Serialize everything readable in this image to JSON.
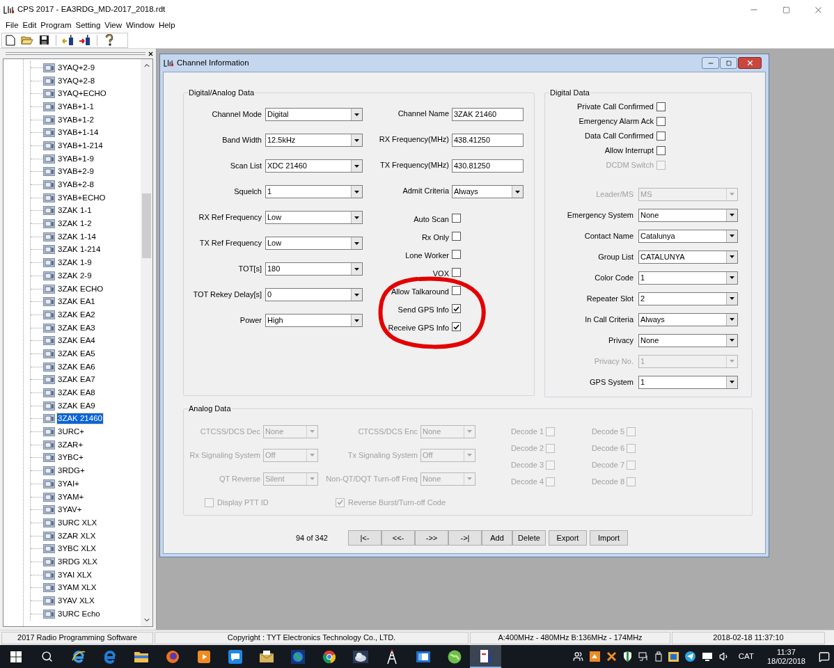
{
  "window": {
    "title": "CPS 2017 - EA3RDG_MD-2017_2018.rdt"
  },
  "menu": [
    "File",
    "Edit",
    "Program",
    "Setting",
    "View",
    "Window",
    "Help"
  ],
  "toolbar": [
    {
      "kind": "new"
    },
    {
      "kind": "open"
    },
    {
      "kind": "save"
    },
    {
      "kind": "read"
    },
    {
      "kind": "write"
    },
    {
      "kind": "help"
    }
  ],
  "tree": {
    "items": [
      {
        "label": "3YAQ+2-9",
        "selected": false
      },
      {
        "label": "3YAQ+2-8",
        "selected": false
      },
      {
        "label": "3YAQ+ECHO",
        "selected": false
      },
      {
        "label": "3YAB+1-1",
        "selected": false
      },
      {
        "label": "3YAB+1-2",
        "selected": false
      },
      {
        "label": "3YAB+1-14",
        "selected": false
      },
      {
        "label": "3YAB+1-214",
        "selected": false
      },
      {
        "label": "3YAB+1-9",
        "selected": false
      },
      {
        "label": "3YAB+2-9",
        "selected": false
      },
      {
        "label": "3YAB+2-8",
        "selected": false
      },
      {
        "label": "3YAB+ECHO",
        "selected": false
      },
      {
        "label": "3ZAK 1-1",
        "selected": false
      },
      {
        "label": "3ZAK 1-2",
        "selected": false
      },
      {
        "label": "3ZAK 1-14",
        "selected": false
      },
      {
        "label": "3ZAK 1-214",
        "selected": false
      },
      {
        "label": "3ZAK 1-9",
        "selected": false
      },
      {
        "label": "3ZAK 2-9",
        "selected": false
      },
      {
        "label": "3ZAK ECHO",
        "selected": false
      },
      {
        "label": "3ZAK EA1",
        "selected": false
      },
      {
        "label": "3ZAK EA2",
        "selected": false
      },
      {
        "label": "3ZAK EA3",
        "selected": false
      },
      {
        "label": "3ZAK EA4",
        "selected": false
      },
      {
        "label": "3ZAK EA5",
        "selected": false
      },
      {
        "label": "3ZAK EA6",
        "selected": false
      },
      {
        "label": "3ZAK EA7",
        "selected": false
      },
      {
        "label": "3ZAK EA8",
        "selected": false
      },
      {
        "label": "3ZAK EA9",
        "selected": false
      },
      {
        "label": "3ZAK 21460",
        "selected": true
      },
      {
        "label": "3URC+",
        "selected": false
      },
      {
        "label": "3ZAR+",
        "selected": false
      },
      {
        "label": "3YBC+",
        "selected": false
      },
      {
        "label": "3RDG+",
        "selected": false
      },
      {
        "label": "3YAI+",
        "selected": false
      },
      {
        "label": "3YAM+",
        "selected": false
      },
      {
        "label": "3YAV+",
        "selected": false
      },
      {
        "label": "3URC XLX",
        "selected": false
      },
      {
        "label": "3ZAR XLX",
        "selected": false
      },
      {
        "label": "3YBC XLX",
        "selected": false
      },
      {
        "label": "3RDG XLX",
        "selected": false
      },
      {
        "label": "3YAI XLX",
        "selected": false
      },
      {
        "label": "3YAM XLX",
        "selected": false
      },
      {
        "label": "3YAV XLX",
        "selected": false
      },
      {
        "label": "3URC Echo",
        "selected": false
      }
    ]
  },
  "channel_window": {
    "title": "Channel Information",
    "digital_analog": {
      "title": "Digital/Analog Data",
      "left_fields": [
        {
          "label": "Channel Mode",
          "value": "Digital"
        },
        {
          "label": "Band Width",
          "value": "12.5kHz"
        },
        {
          "label": "Scan List",
          "value": "XDC 21460"
        },
        {
          "label": "Squelch",
          "value": "1"
        },
        {
          "label": "RX Ref Frequency",
          "value": "Low"
        },
        {
          "label": "TX Ref Frequency",
          "value": "Low"
        },
        {
          "label": "TOT[s]",
          "value": "180"
        },
        {
          "label": "TOT Rekey Delay[s]",
          "value": "0"
        },
        {
          "label": "Power",
          "value": "High"
        }
      ],
      "right_fields": [
        {
          "kind": "text",
          "label": "Channel Name",
          "value": "3ZAK 21460"
        },
        {
          "kind": "text",
          "label": "RX Frequency(MHz)",
          "value": "438.41250"
        },
        {
          "kind": "text",
          "label": "TX Frequency(MHz)",
          "value": "430.81250"
        },
        {
          "kind": "combo",
          "label": "Admit Criteria",
          "value": "Always"
        },
        {
          "kind": "checkbox",
          "label": "Auto Scan",
          "checked": false
        },
        {
          "kind": "checkbox",
          "label": "Rx Only",
          "checked": false
        },
        {
          "kind": "checkbox",
          "label": "Lone Worker",
          "checked": false
        },
        {
          "kind": "checkbox",
          "label": "VOX",
          "checked": false
        },
        {
          "kind": "checkbox",
          "label": "Allow Talkaround",
          "checked": false
        },
        {
          "kind": "checkbox",
          "label": "Send GPS Info",
          "checked": true
        },
        {
          "kind": "checkbox",
          "label": "Receive GPS Info",
          "checked": true
        }
      ]
    },
    "digital": {
      "title": "Digital Data",
      "checkboxes": [
        {
          "label": "Private Call Confirmed",
          "checked": false,
          "disabled": false
        },
        {
          "label": "Emergency Alarm Ack",
          "checked": false,
          "disabled": false
        },
        {
          "label": "Data Call Confirmed",
          "checked": false,
          "disabled": false
        },
        {
          "label": "Allow Interrupt",
          "checked": false,
          "disabled": false
        },
        {
          "label": "DCDM Switch",
          "checked": false,
          "disabled": true
        }
      ],
      "fields": [
        {
          "label": "Leader/MS",
          "value": "MS",
          "disabled": true
        },
        {
          "label": "Emergency System",
          "value": "None",
          "disabled": false
        },
        {
          "label": "Contact Name",
          "value": "Catalunya",
          "disabled": false
        },
        {
          "label": "Group List",
          "value": "CATALUNYA",
          "disabled": false
        },
        {
          "label": "Color Code",
          "value": "1",
          "disabled": false
        },
        {
          "label": "Repeater Slot",
          "value": "2",
          "disabled": false
        },
        {
          "label": "In Call Criteria",
          "value": "Always",
          "disabled": false
        },
        {
          "label": "Privacy",
          "value": "None",
          "disabled": false
        },
        {
          "label": "Privacy No.",
          "value": "1",
          "disabled": true
        },
        {
          "label": "GPS System",
          "value": "1",
          "disabled": false
        }
      ]
    },
    "analog": {
      "title": "Analog Data",
      "disabled": true,
      "left_fields": [
        {
          "label": "CTCSS/DCS Dec",
          "value": "None"
        },
        {
          "label": "Rx Signaling System",
          "value": "Off"
        },
        {
          "label": "QT Reverse",
          "value": "Silent"
        }
      ],
      "right_fields": [
        {
          "label": "CTCSS/DCS Enc",
          "value": "None"
        },
        {
          "label": "Tx Signaling System",
          "value": "Off"
        },
        {
          "label": "Non-QT/DQT Turn-off Freq",
          "value": "None"
        }
      ],
      "decodes": [
        {
          "label": "Decode 1",
          "checked": false
        },
        {
          "label": "Decode 2",
          "checked": false
        },
        {
          "label": "Decode 3",
          "checked": false
        },
        {
          "label": "Decode 4",
          "checked": false
        },
        {
          "label": "Decode 5",
          "checked": false
        },
        {
          "label": "Decode 6",
          "checked": false
        },
        {
          "label": "Decode 7",
          "checked": false
        },
        {
          "label": "Decode 8",
          "checked": false
        }
      ],
      "options": [
        {
          "label": "Display PTT ID",
          "checked": false
        },
        {
          "label": "Reverse Burst/Turn-off Code",
          "checked": true
        }
      ]
    },
    "navigation": {
      "position": "94 of 342",
      "buttons": [
        "|<-",
        "<<-",
        "->>",
        "->|",
        "Add",
        "Delete",
        "Export",
        "Import"
      ]
    }
  },
  "status_bar": [
    "2017 Radio Programming Software",
    "Copyright : TYT Electronics Technology Co., LTD.",
    "A:400MHz - 480MHz B:136MHz - 174MHz",
    "2018-02-18 11:37:10"
  ],
  "taskbar": {
    "apps": [
      {
        "kind": "windows",
        "selected": false
      },
      {
        "kind": "search",
        "selected": false
      },
      {
        "kind": "ie",
        "selected": false
      },
      {
        "kind": "edge",
        "selected": false
      },
      {
        "kind": "folder",
        "selected": false
      },
      {
        "kind": "firefox",
        "selected": false
      },
      {
        "kind": "player",
        "selected": false
      },
      {
        "kind": "chat",
        "selected": false
      },
      {
        "kind": "mail",
        "selected": false
      },
      {
        "kind": "globe",
        "selected": false
      },
      {
        "kind": "chrome",
        "selected": false
      },
      {
        "kind": "cloud",
        "selected": false
      },
      {
        "kind": "tower",
        "selected": false
      },
      {
        "kind": "window",
        "selected": false
      },
      {
        "kind": "earth",
        "selected": false
      },
      {
        "kind": "cps",
        "selected": true
      }
    ],
    "language": "CAT",
    "time": "11:37",
    "date": "18/02/2018"
  }
}
